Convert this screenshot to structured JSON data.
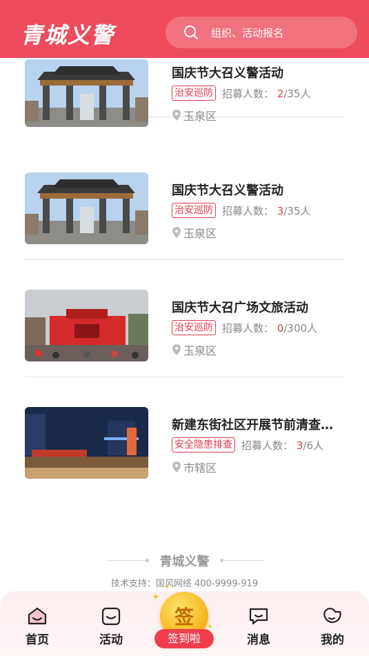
{
  "header": {
    "logo": "青城义警",
    "search_placeholder": "组织、活动报名"
  },
  "activities": [
    {
      "title": "国庆节大召义警活动",
      "tag": "治安巡防",
      "recruit_label": "招募人数：",
      "enrolled": "2",
      "total": "/35人",
      "location": "玉泉区",
      "image": "gate"
    },
    {
      "title": "国庆节大召义警活动",
      "tag": "治安巡防",
      "recruit_label": "招募人数：",
      "enrolled": "3",
      "total": "/35人",
      "location": "玉泉区",
      "image": "gate"
    },
    {
      "title": "国庆节大召广场文旅活动",
      "tag": "治安巡防",
      "recruit_label": "招募人数：",
      "enrolled": "0",
      "total": "/300人",
      "location": "玉泉区",
      "image": "stage"
    },
    {
      "title": "新建东街社区开展节前清查…",
      "tag": "安全隐患排查",
      "recruit_label": "招募人数：",
      "enrolled": "3",
      "total": "/6人",
      "location": "市辖区",
      "image": "night"
    }
  ],
  "footer": {
    "brand": "青城义警",
    "support": "技术支持：国风网络 400-9999-919"
  },
  "tabbar": {
    "home": "首页",
    "activity": "活动",
    "signin_glyph": "签",
    "signin": "签到啦",
    "message": "消息",
    "mine": "我的"
  },
  "colors": {
    "primary": "#ee4b5c",
    "accent_red": "#e23a4c"
  }
}
